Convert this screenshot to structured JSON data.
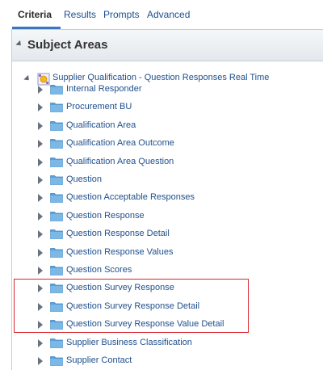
{
  "tabs": [
    {
      "label": "Criteria",
      "active": true
    },
    {
      "label": "Results",
      "active": false
    },
    {
      "label": "Prompts",
      "active": false
    },
    {
      "label": "Advanced",
      "active": false
    }
  ],
  "panel": {
    "title": "Subject Areas",
    "root": {
      "label": "Supplier Qualification - Question Responses Real Time",
      "icon": "subject-area-icon"
    },
    "items": [
      {
        "label": "Internal Responder"
      },
      {
        "label": "Procurement BU"
      },
      {
        "label": "Qualification Area"
      },
      {
        "label": "Qualification Area Outcome"
      },
      {
        "label": "Qualification Area Question"
      },
      {
        "label": "Question"
      },
      {
        "label": "Question Acceptable Responses"
      },
      {
        "label": "Question Response"
      },
      {
        "label": "Question Response Detail"
      },
      {
        "label": "Question Response Values"
      },
      {
        "label": "Question Scores"
      },
      {
        "label": "Question Survey Response"
      },
      {
        "label": "Question Survey Response Detail"
      },
      {
        "label": "Question Survey Response Value Detail"
      },
      {
        "label": "Supplier Business Classification"
      },
      {
        "label": "Supplier Contact"
      }
    ]
  },
  "colors": {
    "link": "#1f4f8c",
    "tab_underline": "#3977c3",
    "folder": "#5aa0d8",
    "highlight_border": "#d9262c"
  }
}
